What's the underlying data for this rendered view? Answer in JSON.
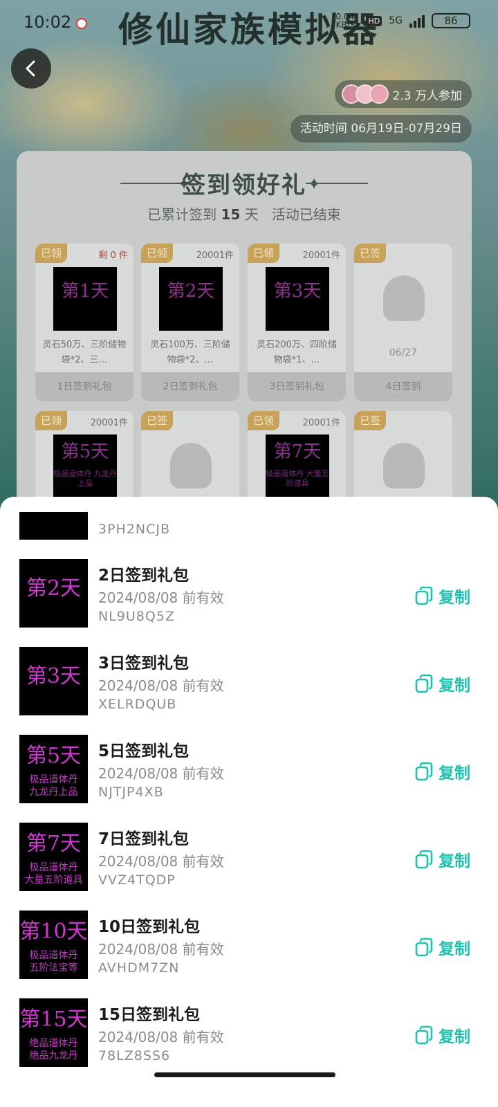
{
  "status": {
    "time": "10:02",
    "net": "0.04 KB/S",
    "hd": "HD",
    "network": "5G",
    "battery": "86"
  },
  "header": {
    "game_title": "修仙家族模拟器",
    "participants": "2.3 万人参加",
    "activity_time": "活动时间 06月19日-07月29日"
  },
  "signin_card": {
    "title": "签到领好礼",
    "days_prefix": "已累计签到",
    "days_count": "15",
    "days_suffix": "天",
    "status": "活动已结束",
    "tiles": [
      {
        "tag": "已领",
        "stock": "剩 0 件",
        "thumb": "第1天",
        "desc": "灵石50万、三阶储物袋*2、三…",
        "footer": "1日签到礼包"
      },
      {
        "tag": "已领",
        "stock": "20001件",
        "thumb": "第2天",
        "desc": "灵石100万、三阶储物袋*2、…",
        "footer": "2日签到礼包"
      },
      {
        "tag": "已领",
        "stock": "20001件",
        "thumb": "第3天",
        "desc": "灵石200万、四阶储物袋*1、…",
        "footer": "3日签到礼包"
      },
      {
        "tag": "已签",
        "date": "06/27",
        "footer": "4日签到"
      },
      {
        "tag": "已领",
        "stock": "20001件",
        "thumb": "第5天",
        "thumb_sub": "极品道体丹 九龙丹上品"
      },
      {
        "tag": "已签"
      },
      {
        "tag": "已领",
        "stock": "20001件",
        "thumb": "第7天",
        "thumb_sub": "极品道体丹 大量五阶道具"
      },
      {
        "tag": "已签"
      }
    ]
  },
  "gift_list": {
    "copy_label": "复制",
    "partial_top": {
      "code": "3PH2NCJB"
    },
    "items": [
      {
        "thumb": "第2天",
        "thumb_sub1": "",
        "thumb_sub2": "",
        "name": "2日签到礼包",
        "valid": "2024/08/08 前有效",
        "code": "NL9U8Q5Z"
      },
      {
        "thumb": "第3天",
        "thumb_sub1": "",
        "thumb_sub2": "",
        "name": "3日签到礼包",
        "valid": "2024/08/08 前有效",
        "code": "XELRDQUB"
      },
      {
        "thumb": "第5天",
        "thumb_sub1": "极品道体丹",
        "thumb_sub2": "九龙丹上品",
        "name": "5日签到礼包",
        "valid": "2024/08/08 前有效",
        "code": "NJTJP4XB"
      },
      {
        "thumb": "第7天",
        "thumb_sub1": "极品道体丹",
        "thumb_sub2": "大量五阶道具",
        "name": "7日签到礼包",
        "valid": "2024/08/08 前有效",
        "code": "VVZ4TQDP"
      },
      {
        "thumb": "第10天",
        "thumb_sub1": "极品道体丹",
        "thumb_sub2": "五阶法宝等",
        "name": "10日签到礼包",
        "valid": "2024/08/08 前有效",
        "code": "AVHDM7ZN"
      },
      {
        "thumb": "第15天",
        "thumb_sub1": "绝品道体丹",
        "thumb_sub2": "绝品九龙丹",
        "name": "15日签到礼包",
        "valid": "2024/08/08 前有效",
        "code": "78LZ8SS6"
      }
    ]
  },
  "colors": {
    "accent": "#1ec2b0",
    "tag_gold": "#c8a25a",
    "thumb_magenta": "#d037d0"
  }
}
